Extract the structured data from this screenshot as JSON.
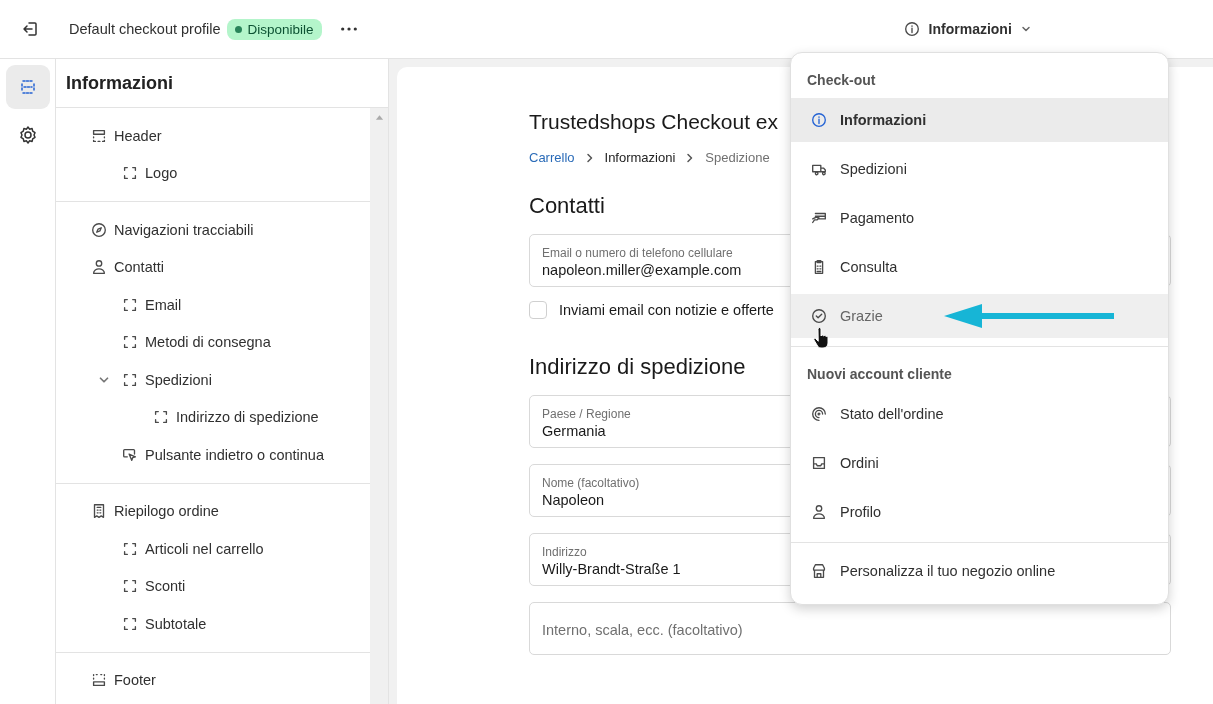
{
  "top_bar": {
    "title": "Default checkout profile",
    "status_badge": "Disponibile",
    "page_selector": "Informazioni"
  },
  "rail": [
    {
      "selected": true
    },
    {
      "selected": false
    }
  ],
  "sidebar": {
    "title": "Informazioni",
    "groups": [
      {
        "items": [
          {
            "label": "Header",
            "kind": "header",
            "children": [
              {
                "label": "Logo",
                "kind": "block"
              }
            ]
          }
        ]
      },
      {
        "items": [
          {
            "label": "Navigazioni tracciabili",
            "kind": "compass"
          },
          {
            "label": "Contatti",
            "kind": "person",
            "children": [
              {
                "label": "Email",
                "kind": "block"
              },
              {
                "label": "Metodi di consegna",
                "kind": "block"
              },
              {
                "label": "Spedizioni",
                "kind": "block",
                "expanded": true,
                "children": [
                  {
                    "label": "Indirizzo di spedizione",
                    "kind": "block"
                  }
                ]
              },
              {
                "label": "Pulsante indietro o continua",
                "kind": "pointer"
              }
            ]
          }
        ]
      },
      {
        "items": [
          {
            "label": "Riepilogo ordine",
            "kind": "receipt",
            "children": [
              {
                "label": "Articoli nel carrello",
                "kind": "block"
              },
              {
                "label": "Sconti",
                "kind": "block"
              },
              {
                "label": "Subtotale",
                "kind": "block"
              }
            ]
          }
        ]
      },
      {
        "items": [
          {
            "label": "Footer",
            "kind": "footer"
          }
        ]
      }
    ]
  },
  "preview": {
    "shop_title": "Trustedshops Checkout ex",
    "breadcrumbs": [
      {
        "label": "Carrello",
        "kind": "link"
      },
      {
        "label": "Informazioni",
        "kind": "current"
      },
      {
        "label": "Spedizione",
        "kind": "future"
      }
    ],
    "contact_heading": "Contatti",
    "email_field": {
      "label": "Email o numero di telefono cellulare",
      "value": "napoleon.miller@example.com"
    },
    "newsletter": {
      "label": "Inviami email con notizie e offerte",
      "checked": false
    },
    "shipping_heading": "Indirizzo di spedizione",
    "fields": [
      {
        "label": "Paese / Regione",
        "value": "Germania"
      },
      {
        "label": "Nome (facoltativo)",
        "value": "Napoleon"
      },
      {
        "label": "Indirizzo",
        "value": "Willy-Brandt-Straße 1"
      },
      {
        "placeholder": "Interno, scala, ecc. (facoltativo)"
      }
    ]
  },
  "page_menu": {
    "sections": [
      {
        "heading": "Check-out",
        "items": [
          {
            "label": "Informazioni",
            "kind": "info",
            "selected": true,
            "hovered": false
          },
          {
            "label": "Spedizioni",
            "kind": "truck",
            "selected": false,
            "hovered": false
          },
          {
            "label": "Pagamento",
            "kind": "hand-card",
            "selected": false,
            "hovered": false
          },
          {
            "label": "Consulta",
            "kind": "clipboard",
            "selected": false,
            "hovered": false
          },
          {
            "label": "Grazie",
            "kind": "check-circle",
            "selected": false,
            "hovered": true
          }
        ]
      },
      {
        "heading": "Nuovi account cliente",
        "items": [
          {
            "label": "Stato dell'ordine",
            "kind": "spiral",
            "selected": false,
            "hovered": false
          },
          {
            "label": "Ordini",
            "kind": "inbox",
            "selected": false,
            "hovered": false
          },
          {
            "label": "Profilo",
            "kind": "person",
            "selected": false,
            "hovered": false
          }
        ]
      },
      {
        "items": [
          {
            "label": "Personalizza il tuo negozio online",
            "kind": "store",
            "selected": false,
            "hovered": false
          }
        ]
      }
    ]
  }
}
